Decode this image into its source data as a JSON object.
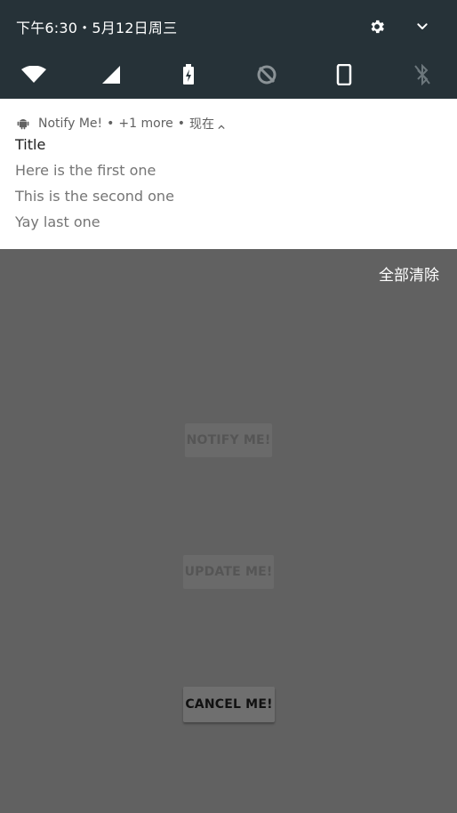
{
  "status_header": {
    "datetime": "下午6:30・5月12日周三",
    "icons": [
      "gear-icon",
      "chevron-down-icon"
    ]
  },
  "quick_settings": {
    "tiles": [
      "wifi-icon",
      "cellular-signal-icon",
      "battery-charging-icon",
      "data-saver-off-icon",
      "rotation-lock-icon",
      "bluetooth-off-icon"
    ]
  },
  "notification": {
    "app_name": "Notify Me!",
    "more": "+1 more",
    "time": "现在",
    "title": "Title",
    "lines": [
      "Here is the first one",
      "This is the second one",
      "Yay last one"
    ]
  },
  "shade_actions": {
    "clear_all": "全部清除"
  },
  "app_buttons": {
    "notify": "NOTIFY ME!",
    "update": "UPDATE ME!",
    "cancel": "CANCEL ME!"
  },
  "colors": {
    "header_bg": "#263238",
    "scrim": "#616161",
    "card_bg": "#ffffff"
  }
}
